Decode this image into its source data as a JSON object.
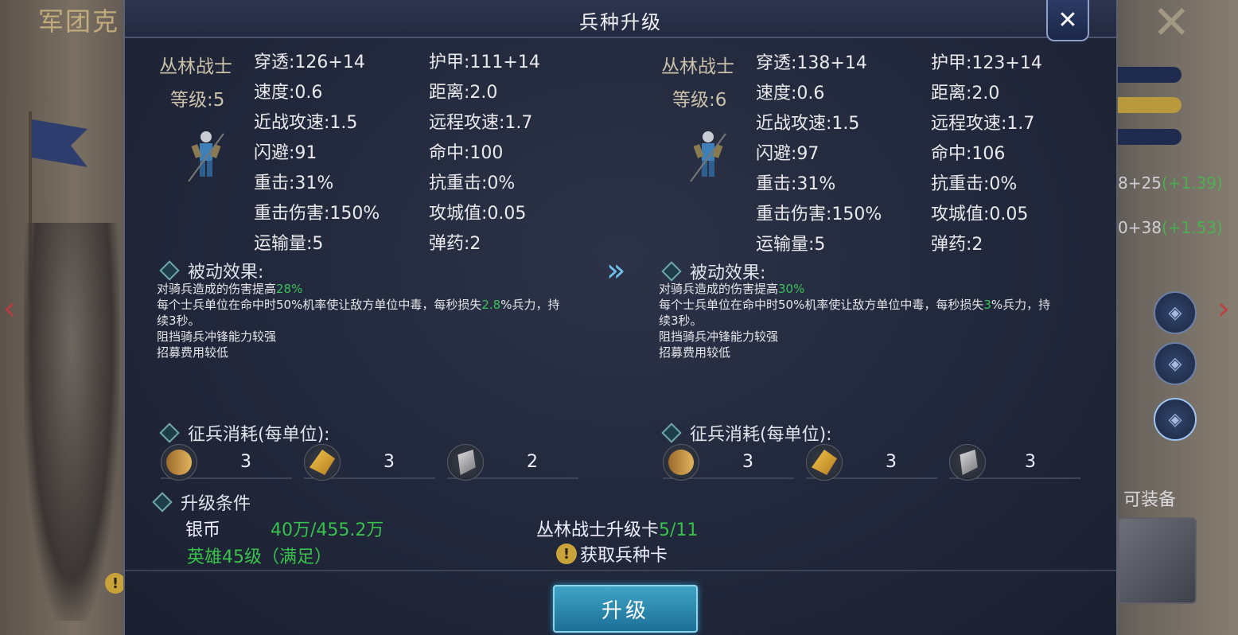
{
  "background": {
    "left_title": "军团克",
    "side_stats": [
      {
        "value": "8+25",
        "delta": "(+1.39)"
      },
      {
        "value": "0+38",
        "delta": "(+1.53)"
      }
    ],
    "side_label": "可装备"
  },
  "dialog": {
    "title": "兵种升级",
    "close_label": "✕"
  },
  "current": {
    "name": "丛林战士",
    "level": "等级:5",
    "stats_left": [
      "穿透:126+14",
      "速度:0.6",
      "近战攻速:1.5",
      "闪避:91",
      "重击:31%",
      "重击伤害:150%",
      "运输量:5"
    ],
    "stats_right": [
      "护甲:111+14",
      "距离:2.0",
      "远程攻速:1.7",
      "命中:100",
      "抗重击:0%",
      "攻城值:0.05",
      "弹药:2"
    ],
    "passive_title": "被动效果:",
    "passive": {
      "line1_prefix": "对骑兵造成的伤害提高",
      "line1_value": "28",
      "line1_suffix": "%",
      "line2_prefix": "每个士兵单位在命中时50%机率使让敌方单位中毒，每秒损失",
      "line2_value": "2.8",
      "line2_suffix": "%兵力，持",
      "line3": "续3秒。",
      "line4": "阻挡骑兵冲锋能力较强",
      "line5": "招募费用较低"
    },
    "cost_title": "征兵消耗(每单位):",
    "costs": [
      {
        "icon": "wood-icon",
        "value": "3"
      },
      {
        "icon": "wheat-icon",
        "value": "3"
      },
      {
        "icon": "iron-icon",
        "value": "2"
      }
    ]
  },
  "next": {
    "name": "丛林战士",
    "level": "等级:6",
    "stats_left": [
      "穿透:138+14",
      "速度:0.6",
      "近战攻速:1.5",
      "闪避:97",
      "重击:31%",
      "重击伤害:150%",
      "运输量:5"
    ],
    "stats_right": [
      "护甲:123+14",
      "距离:2.0",
      "远程攻速:1.7",
      "命中:106",
      "抗重击:0%",
      "攻城值:0.05",
      "弹药:2"
    ],
    "passive_title": "被动效果:",
    "passive": {
      "line1_prefix": "对骑兵造成的伤害提高",
      "line1_value": "30",
      "line1_suffix": "%",
      "line2_prefix": "每个士兵单位在命中时50%机率使让敌方单位中毒，每秒损失",
      "line2_value": "3",
      "line2_suffix": "%兵力，持",
      "line3": "续3秒。",
      "line4": "阻挡骑兵冲锋能力较强",
      "line5": "招募费用较低"
    },
    "cost_title": "征兵消耗(每单位):",
    "costs": [
      {
        "icon": "wood-icon",
        "value": "3"
      },
      {
        "icon": "wheat-icon",
        "value": "3"
      },
      {
        "icon": "iron-icon",
        "value": "3"
      }
    ]
  },
  "upgrade_conditions": {
    "title": "升级条件",
    "silver_label": "银币",
    "silver_value": "40万/455.2万",
    "hero_req": "英雄45级（满足）",
    "card_label": "丛林战士升级卡",
    "card_value": "5/11",
    "get_card": "获取兵种卡"
  },
  "upgrade_button": "升级",
  "colors": {
    "accent_green": "#38c14c",
    "button_blue": "#2a8fbf",
    "panel_bg": "#22283b"
  }
}
